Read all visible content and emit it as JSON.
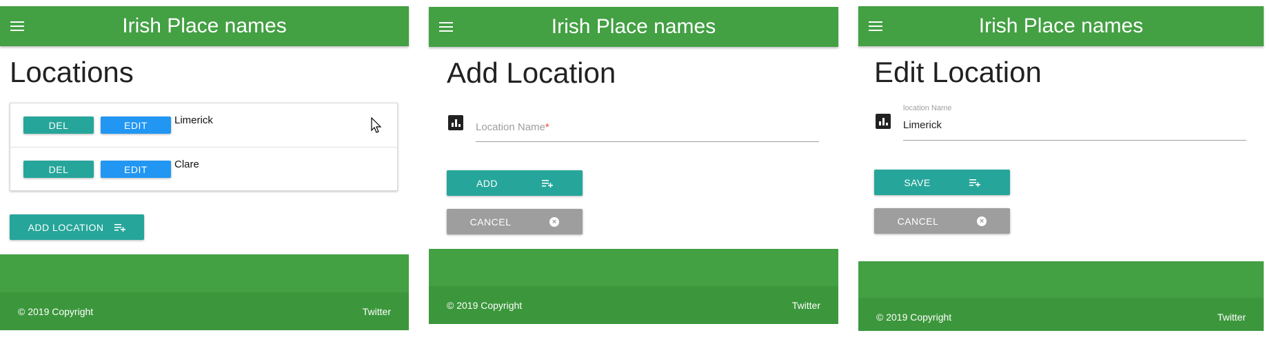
{
  "app_title": "Irish Place names",
  "footer": {
    "copyright": "© 2019 Copyright",
    "twitter": "Twitter"
  },
  "list_view": {
    "page_title": "Locations",
    "rows": [
      {
        "del_label": "DEL",
        "edit_label": "EDIT",
        "name": "Limerick"
      },
      {
        "del_label": "DEL",
        "edit_label": "EDIT",
        "name": "Clare"
      }
    ],
    "add_button_label": "ADD LOCATION"
  },
  "add_view": {
    "page_title": "Add Location",
    "field_placeholder": "Location Name",
    "required_mark": "*",
    "add_label": "ADD",
    "cancel_label": "CANCEL"
  },
  "edit_view": {
    "page_title": "Edit Location",
    "field_label": "location Name",
    "field_value": "Limerick",
    "save_label": "SAVE",
    "cancel_label": "CANCEL"
  },
  "colors": {
    "primary": "#43a043",
    "teal": "#26a69a",
    "blue": "#2196f3",
    "grey": "#9e9e9e"
  },
  "icons": [
    "menu-icon",
    "playlist-add-icon",
    "cancel-circle-icon",
    "bar-chart-icon",
    "mouse-cursor-icon"
  ]
}
